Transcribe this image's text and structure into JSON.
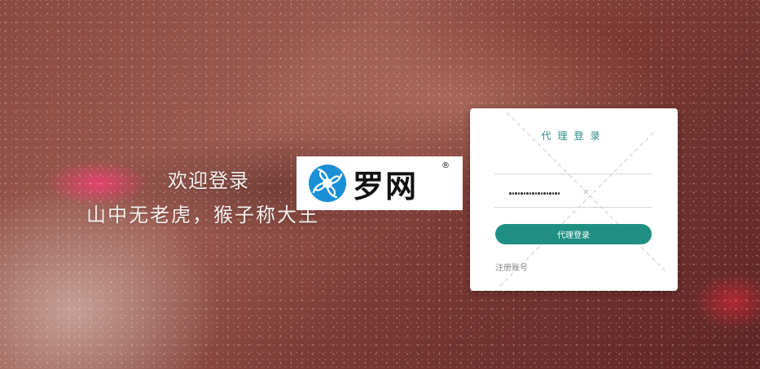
{
  "welcome": {
    "title": "欢迎登录",
    "slogan": "山中无老虎，猴子称大王"
  },
  "logo": {
    "text": "罗网",
    "registered": "®",
    "brand_color": "#1a8fd6"
  },
  "login_panel": {
    "title": "代理登录",
    "username_placeholder": "",
    "password_value": "••••••••••••••••••",
    "password_length": 18,
    "login_button": "代理登录",
    "register_link": "注册账号",
    "accent_color": "#1f8f83"
  }
}
